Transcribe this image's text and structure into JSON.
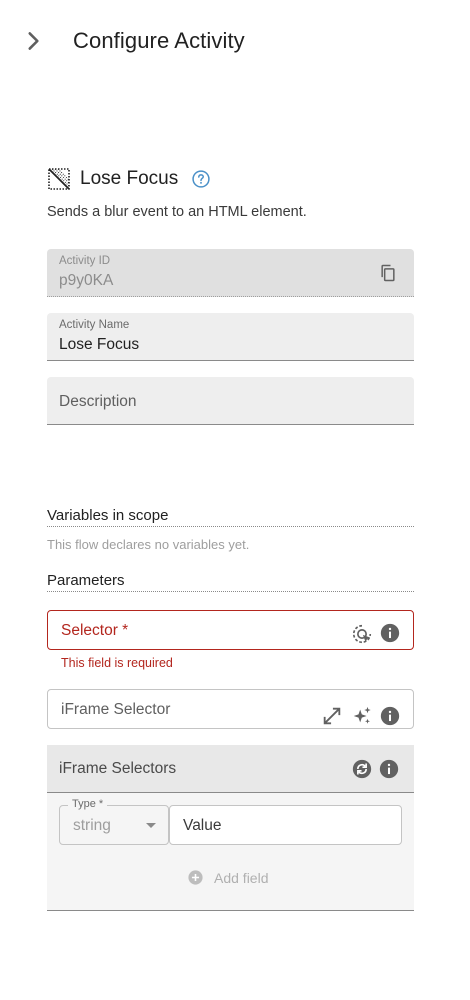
{
  "header": {
    "title": "Configure Activity",
    "collapse_icon": "chevron-right-icon"
  },
  "activity": {
    "icon": "lose-focus-icon",
    "title": "Lose Focus",
    "help_icon": "help-circle-icon",
    "description": "Sends a blur event to an HTML element."
  },
  "fields": {
    "activity_id": {
      "label": "Activity ID",
      "value": "p9y0KA",
      "icon": "copy-icon"
    },
    "activity_name": {
      "label": "Activity Name",
      "value": "Lose Focus"
    },
    "description": {
      "placeholder": "Description"
    }
  },
  "variables": {
    "title": "Variables in scope",
    "empty_text": "This flow declares no variables yet."
  },
  "parameters": {
    "title": "Parameters",
    "selector": {
      "placeholder": "Selector *",
      "error": "This field is required",
      "icons": [
        "target-picker-icon",
        "info-icon"
      ]
    },
    "iframe_selector": {
      "placeholder": "iFrame Selector",
      "icons": [
        "expand-icon",
        "sparkle-icon",
        "info-icon"
      ]
    },
    "iframe_selectors": {
      "title": "iFrame Selectors",
      "icons": [
        "sync-icon",
        "info-icon"
      ],
      "type_label": "Type *",
      "type_value": "string",
      "value_placeholder": "Value",
      "add_label": "Add field"
    }
  },
  "colors": {
    "error": "#b3261e",
    "help_blue": "#4a90c8",
    "icon_gray": "#616161"
  }
}
